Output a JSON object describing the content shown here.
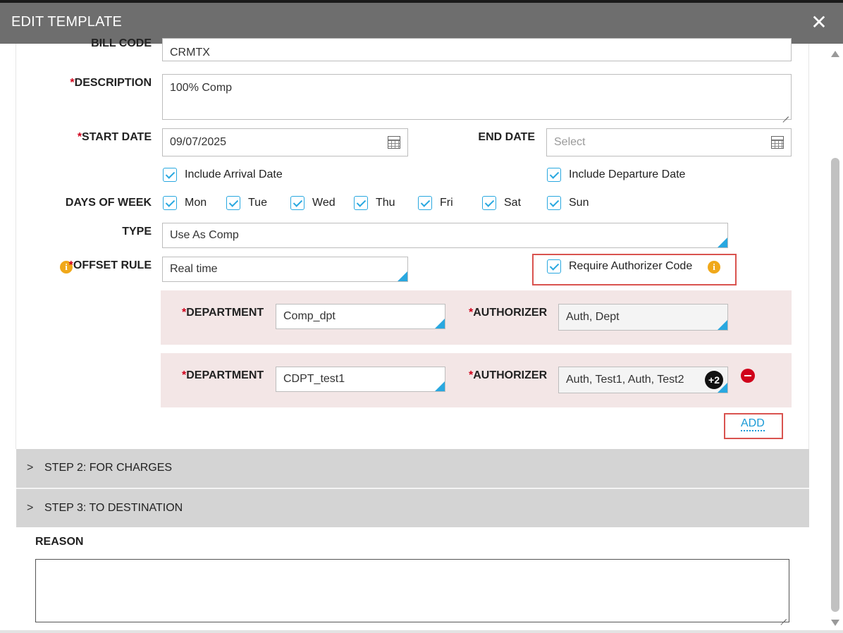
{
  "dialog": {
    "title": "EDIT TEMPLATE"
  },
  "bill_code": {
    "label": "BILL CODE",
    "value": "CRMTX"
  },
  "description": {
    "label": "DESCRIPTION",
    "value": "100% Comp"
  },
  "start_date": {
    "label": "START DATE",
    "value": "09/07/2025"
  },
  "end_date": {
    "label": "END DATE",
    "placeholder": "Select"
  },
  "include_arrival": {
    "label": "Include Arrival Date",
    "checked": true
  },
  "include_departure": {
    "label": "Include Departure Date",
    "checked": true
  },
  "days_of_week": {
    "label": "DAYS OF WEEK",
    "days": [
      {
        "label": "Mon",
        "checked": true
      },
      {
        "label": "Tue",
        "checked": true
      },
      {
        "label": "Wed",
        "checked": true
      },
      {
        "label": "Thu",
        "checked": true
      },
      {
        "label": "Fri",
        "checked": true
      },
      {
        "label": "Sat",
        "checked": true
      },
      {
        "label": "Sun",
        "checked": true
      }
    ]
  },
  "type": {
    "label": "TYPE",
    "value": "Use As Comp"
  },
  "offset_rule": {
    "label": "OFFSET RULE",
    "value": "Real time",
    "icon": "info-icon"
  },
  "require_authorizer": {
    "label": "Require Authorizer Code",
    "checked": true,
    "icon": "info-icon"
  },
  "department_rows": [
    {
      "dept_label": "DEPARTMENT",
      "dept_value": "Comp_dpt",
      "auth_label": "AUTHORIZER",
      "auth_value": "Auth, Dept"
    },
    {
      "dept_label": "DEPARTMENT",
      "dept_value": "CDPT_test1",
      "auth_label": "AUTHORIZER",
      "auth_value": "Auth, Test1, Auth, Test2",
      "more_badge": "+2",
      "remove_icon": "minus-circle-icon"
    }
  ],
  "add_link": "ADD",
  "required_marker": "*",
  "steps": [
    {
      "chevron": ">",
      "label": "STEP 2: FOR CHARGES"
    },
    {
      "chevron": ">",
      "label": "STEP 3: TO DESTINATION"
    }
  ],
  "reason": {
    "label": "REASON",
    "value": ""
  },
  "colors": {
    "accent": "#29a8e0",
    "required": "#d0021b",
    "highlight": "#d9534f",
    "info": "#f0a81a",
    "titlebar": "#6e6e6e"
  }
}
